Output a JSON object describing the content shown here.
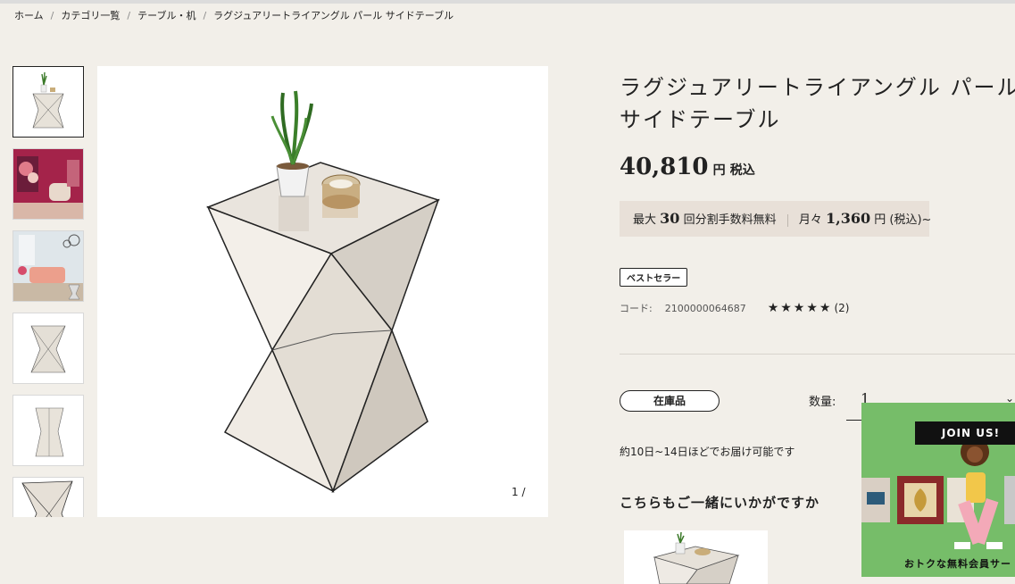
{
  "breadcrumb": {
    "home": "ホーム",
    "category": "カテゴリ一覧",
    "subcategory": "テーブル・机",
    "current": "ラグジュアリートライアングル パール サイドテーブル"
  },
  "product": {
    "title": "ラグジュアリートライアングル パール サイドテーブル",
    "price": "40,810",
    "price_unit": "円",
    "price_tax": "税込",
    "installment": {
      "max_label": "最大",
      "max_count": "30",
      "max_suffix": "回分割手数料無料",
      "monthly_label": "月々",
      "monthly_amount": "1,360",
      "monthly_suffix": "円 (税込)~"
    },
    "badge": "ベストセラー",
    "code_label": "コード:",
    "code_value": "2100000064687",
    "rating_stars": "★★★★★",
    "rating_count": "(2)",
    "stock_label": "在庫品",
    "quantity_label": "数量:",
    "quantity_value": "1",
    "delivery": "約10日~14日ほどでお届け可能です",
    "recommend_heading": "こちらもご一緒にいかがですか"
  },
  "gallery": {
    "counter": "1 /",
    "thumbnail_count": 6,
    "active_index": 0
  },
  "promo": {
    "join_label": "JOIN US!",
    "caption": "おトクな無料会員サー"
  },
  "colors": {
    "background": "#f2efe9",
    "installment_bg": "#e8e0d8",
    "promo_bg": "#76bd69"
  }
}
